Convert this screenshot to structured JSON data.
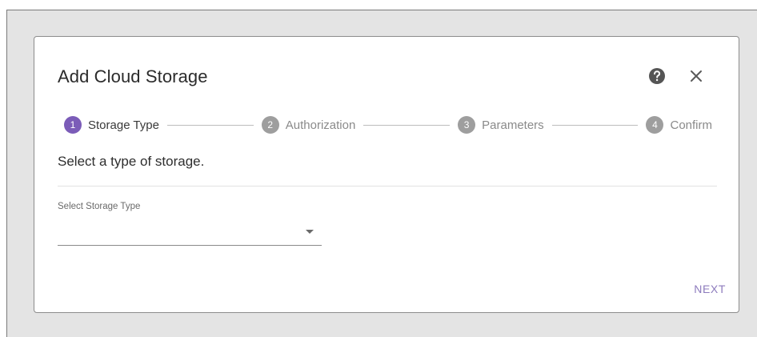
{
  "dialog": {
    "title": "Add Cloud Storage",
    "help_icon": "question-circle-icon",
    "close_icon": "close-icon",
    "subtitle": "Select a type of storage."
  },
  "stepper": {
    "active_step": 1,
    "steps": [
      {
        "number": "1",
        "label": "Storage Type"
      },
      {
        "number": "2",
        "label": "Authorization"
      },
      {
        "number": "3",
        "label": "Parameters"
      },
      {
        "number": "4",
        "label": "Confirm"
      }
    ]
  },
  "storage_type_select": {
    "label": "Select Storage Type",
    "value": ""
  },
  "actions": {
    "next_label": "NEXT"
  },
  "colors": {
    "accent": "#7b5cb8",
    "inactive_step": "#9e9e9e",
    "next_text": "#8d7bbd",
    "backdrop": "#e4e4e4"
  }
}
